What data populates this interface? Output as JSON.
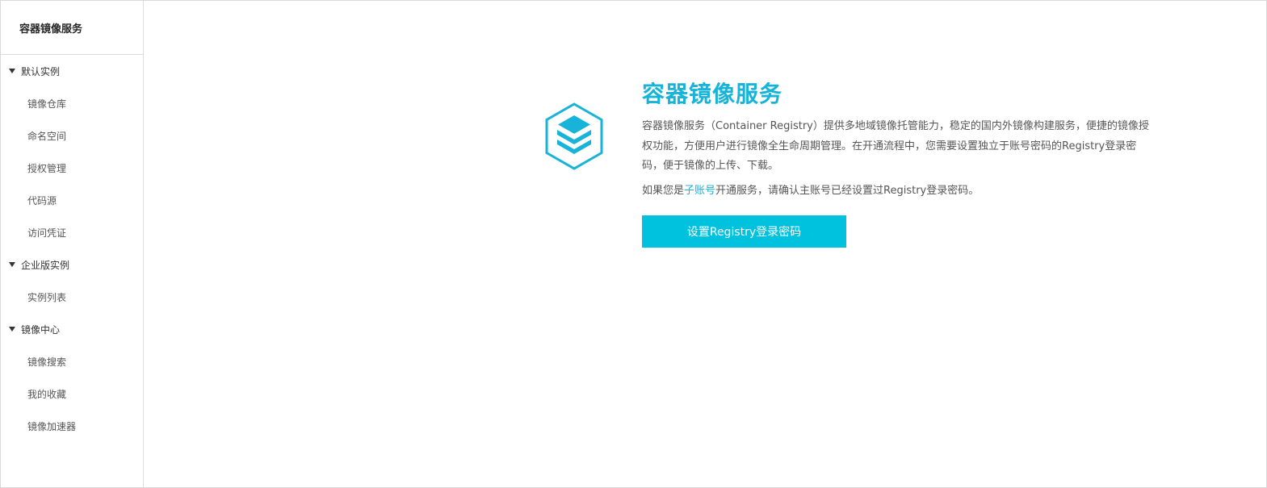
{
  "sidebar": {
    "title": "容器镜像服务",
    "groups": [
      {
        "label": "默认实例",
        "items": [
          "镜像仓库",
          "命名空间",
          "授权管理",
          "代码源",
          "访问凭证"
        ]
      },
      {
        "label": "企业版实例",
        "items": [
          "实例列表"
        ]
      },
      {
        "label": "镜像中心",
        "items": [
          "镜像搜索",
          "我的收藏",
          "镜像加速器"
        ]
      }
    ]
  },
  "main": {
    "title": "容器镜像服务",
    "description": "容器镜像服务（Container Registry）提供多地域镜像托管能力，稳定的国内外镜像构建服务，便捷的镜像授权功能，方便用户进行镜像全生命周期管理。在开通流程中，您需要设置独立于账号密码的Registry登录密码，便于镜像的上传、下载。",
    "note_prefix": "如果您是",
    "note_link": "子账号",
    "note_suffix": "开通服务，请确认主账号已经设置过Registry登录密码。",
    "button_label": "设置Registry登录密码"
  },
  "colors": {
    "accent": "#17b3d8",
    "button": "#00c1de"
  },
  "icons": {
    "logo": "container-registry-logo-icon",
    "group_toggle": "caret-down-icon"
  }
}
